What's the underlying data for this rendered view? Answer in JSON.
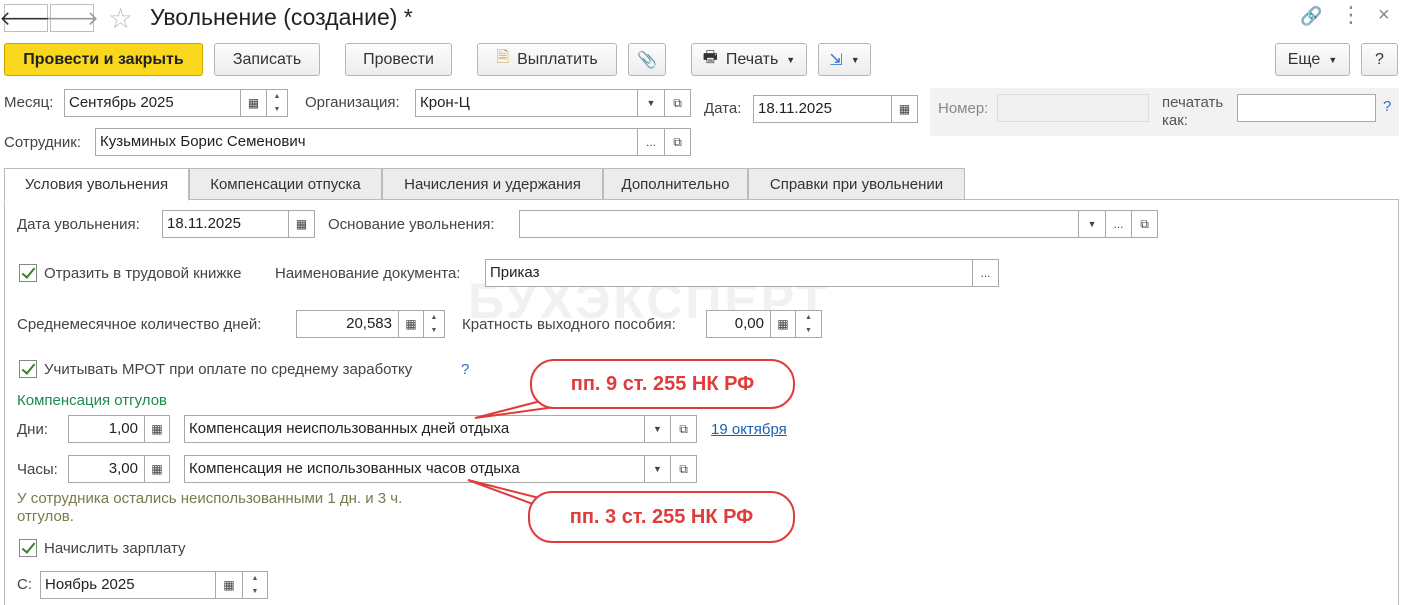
{
  "window": {
    "title": "Увольнение (создание) *"
  },
  "toolbar": {
    "post_close": "Провести и закрыть",
    "save": "Записать",
    "post": "Провести",
    "pay": "Выплатить",
    "print": "Печать",
    "more": "Еще",
    "help": "?"
  },
  "header": {
    "month_label": "Месяц:",
    "month_value": "Сентябрь 2025",
    "org_label": "Организация:",
    "org_value": "Крон-Ц",
    "date_label": "Дата:",
    "date_value": "18.11.2025",
    "number_label": "Номер:",
    "number_value": "",
    "print_as_label1": "печатать",
    "print_as_label2": "как:",
    "print_as_value": "",
    "help": "?",
    "employee_label": "Сотрудник:",
    "employee_value": "Кузьминых Борис Семенович"
  },
  "tabs": [
    {
      "label": "Условия увольнения",
      "active": true
    },
    {
      "label": "Компенсации отпуска",
      "active": false
    },
    {
      "label": "Начисления и удержания",
      "active": false
    },
    {
      "label": "Дополнительно",
      "active": false
    },
    {
      "label": "Справки при увольнении",
      "active": false
    }
  ],
  "form": {
    "dismissal_date_label": "Дата увольнения:",
    "dismissal_date_value": "18.11.2025",
    "reason_label": "Основание увольнения:",
    "reason_value": "",
    "workbook_checkbox_label": "Отразить в трудовой книжке",
    "workbook_checked": true,
    "doc_name_label": "Наименование документа:",
    "doc_name_value": "Приказ",
    "avg_days_label": "Среднемесячное количество дней:",
    "avg_days_value": "20,583",
    "severance_label": "Кратность выходного пособия:",
    "severance_value": "0,00",
    "mrot_label": "Учитывать МРОТ при оплате по среднему заработку",
    "mrot_checked": true,
    "mrot_help": "?",
    "comp_section_title": "Компенсация отгулов",
    "days_label": "Дни:",
    "days_value": "1,00",
    "days_type": "Компенсация неиспользованных дней отдыха",
    "days_link": "19 октября",
    "hours_label": "Часы:",
    "hours_value": "3,00",
    "hours_type": "Компенсация не использованных часов отдыха",
    "info_line1": "У сотрудника остались неиспользованными 1 дн. и 3 ч.",
    "info_line2": "отгулов.",
    "salary_label": "Начислить зарплату",
    "salary_checked": true,
    "from_label": "С:",
    "from_value": "Ноябрь 2025"
  },
  "callouts": {
    "first": "пп. 9 ст. 255 НК РФ",
    "second": "пп. 3 ст. 255 НК РФ"
  },
  "watermark": "БУХЭКСПЕРТ",
  "colors": {
    "primary_button": "#f9d71c",
    "section_title": "#1c8a4a",
    "info_text": "#7a7a4a",
    "link": "#1a5fb4",
    "callout": "#e03c3c"
  }
}
